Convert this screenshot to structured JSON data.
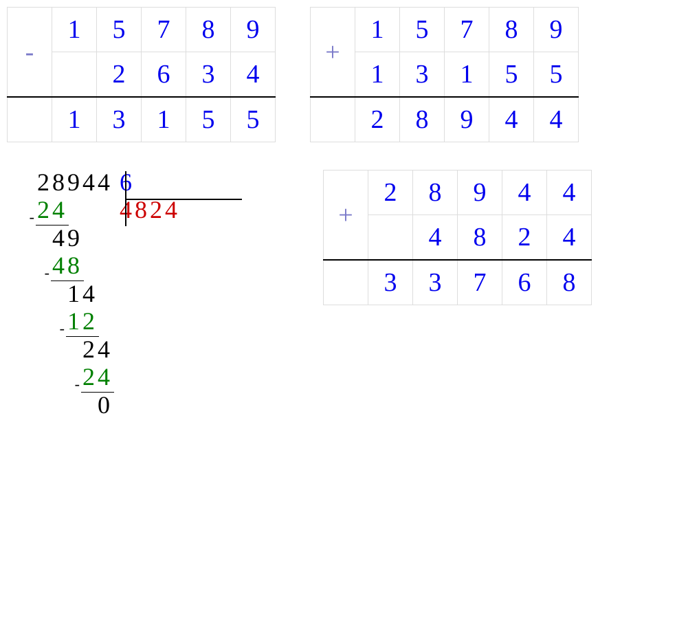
{
  "subtraction": {
    "op": "-",
    "row1": [
      "1",
      "5",
      "7",
      "8",
      "9"
    ],
    "row2": [
      "",
      "2",
      "6",
      "3",
      "4"
    ],
    "result": [
      "1",
      "3",
      "1",
      "5",
      "5"
    ]
  },
  "addition1": {
    "op": "+",
    "row1": [
      "1",
      "5",
      "7",
      "8",
      "9"
    ],
    "row2": [
      "1",
      "3",
      "1",
      "5",
      "5"
    ],
    "result": [
      "2",
      "8",
      "9",
      "4",
      "4"
    ]
  },
  "addition2": {
    "op": "+",
    "row1": [
      "2",
      "8",
      "9",
      "4",
      "4"
    ],
    "row2": [
      "",
      "4",
      "8",
      "2",
      "4"
    ],
    "result": [
      "3",
      "3",
      "7",
      "6",
      "8"
    ]
  },
  "longdiv": {
    "dividend": [
      "2",
      "8",
      "9",
      "4",
      "4"
    ],
    "divisor": "6",
    "quotient": [
      "4",
      "8",
      "2",
      "4"
    ],
    "steps": [
      {
        "sub": [
          "2",
          "4"
        ],
        "indent": 0,
        "bring": [
          "4",
          "9"
        ],
        "bring_indent": 1
      },
      {
        "sub": [
          "4",
          "8"
        ],
        "indent": 1,
        "bring": [
          "1",
          "4"
        ],
        "bring_indent": 2
      },
      {
        "sub": [
          "1",
          "2"
        ],
        "indent": 2,
        "bring": [
          "2",
          "4"
        ],
        "bring_indent": 3
      },
      {
        "sub": [
          "2",
          "4"
        ],
        "indent": 3,
        "bring": [
          "0"
        ],
        "bring_indent": 4
      }
    ]
  }
}
